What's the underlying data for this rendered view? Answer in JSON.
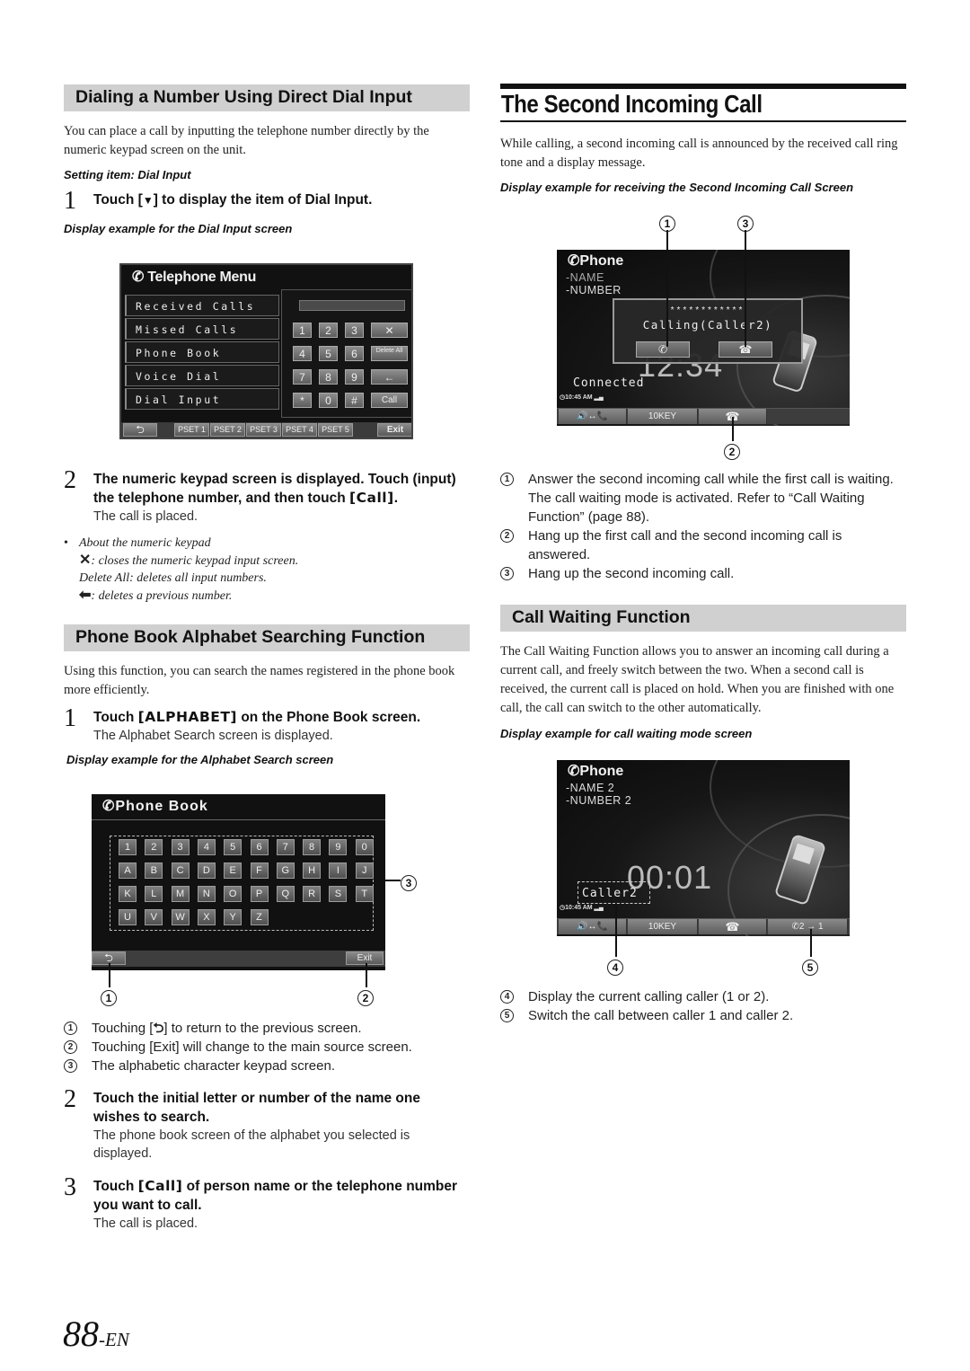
{
  "left": {
    "dial_section": {
      "heading": "Dialing a Number Using Direct Dial Input",
      "intro": "You can place a call by inputting the telephone number directly by the numeric keypad screen on the unit.",
      "setting_item": "Setting item: Dial Input",
      "step1": {
        "num": "1",
        "title_pre": "Touch [",
        "title_icon": "▼",
        "title_post": "] to display the item of Dial Input."
      },
      "caption": "Display example for the Dial Input screen",
      "screen": {
        "title": "Telephone Menu",
        "menu_items": [
          "Received Calls",
          "Missed Calls",
          "Phone Book",
          "Voice Dial",
          "Dial Input"
        ],
        "keypad_rows": [
          [
            "1",
            "2",
            "3",
            "✕"
          ],
          [
            "4",
            "5",
            "6",
            "Delete All"
          ],
          [
            "7",
            "8",
            "9",
            "←"
          ],
          [
            "*",
            "0",
            "#",
            "Call"
          ]
        ],
        "bottom_buttons": [
          "PSET 1",
          "PSET 2",
          "PSET 3",
          "PSET 4",
          "PSET 5"
        ],
        "back_label": "⮌",
        "exit_label": "Exit"
      },
      "step2": {
        "num": "2",
        "title_a": "The numeric keypad screen is displayed. Touch (input) the telephone number, and then touch ",
        "title_key": "[Call]",
        "title_b": ".",
        "note": "The call is placed."
      },
      "keypad_notes": {
        "bullet": "About the numeric keypad",
        "close_desc": ": closes the numeric keypad input screen.",
        "delete_all_desc": "Delete All: deletes all input numbers.",
        "backspace_desc": ": deletes a previous number."
      }
    },
    "alpha_section": {
      "heading": "Phone Book Alphabet Searching Function",
      "intro": "Using this function, you can search the names registered in the phone book more efficiently.",
      "step1": {
        "num": "1",
        "title_pre": "Touch ",
        "title_key": "[ALPHABET]",
        "title_post": " on the Phone Book screen.",
        "note": "The Alphabet Search screen is displayed."
      },
      "caption": "Display example for the Alphabet Search screen",
      "screen": {
        "title": "Phone Book",
        "keys": [
          [
            "1",
            "2",
            "3",
            "4",
            "5",
            "6",
            "7",
            "8",
            "9",
            "0"
          ],
          [
            "A",
            "B",
            "C",
            "D",
            "E",
            "F",
            "G",
            "H",
            "I",
            "J"
          ],
          [
            "K",
            "L",
            "M",
            "N",
            "O",
            "P",
            "Q",
            "R",
            "S",
            "T"
          ],
          [
            "U",
            "V",
            "W",
            "X",
            "Y",
            "Z"
          ]
        ],
        "exit_label": "Exit"
      },
      "callouts": [
        {
          "num": "1",
          "pre": "Touching [",
          "post": "] to return to the previous screen."
        },
        {
          "num": "2",
          "text": "Touching [Exit] will change to the main source screen."
        },
        {
          "num": "3",
          "text": "The alphabetic character keypad screen."
        }
      ],
      "step2": {
        "num": "2",
        "title": "Touch the initial letter or number of the name one wishes to search.",
        "note": "The phone book screen of the alphabet you selected is displayed."
      },
      "step3": {
        "num": "3",
        "title_pre": "Touch ",
        "title_key": "[Call]",
        "title_post": " of person name or the telephone number you want to call.",
        "note": "The call is placed."
      }
    }
  },
  "right": {
    "second_call": {
      "heading": "The Second Incoming Call",
      "intro": "While calling, a second incoming call is announced by the received call ring tone and a display message.",
      "caption": "Display example for receiving the Second Incoming Call Screen",
      "screen": {
        "title": "Phone",
        "name": "-NAME",
        "number": "-NUMBER",
        "stars": "************",
        "message": "Calling(Caller2)",
        "timer": "12:34",
        "status_text": "Connected",
        "clock": "10:45",
        "ampm": "AM",
        "bar_buttons": [
          "🔊↔📞",
          "10KEY",
          "hang-up"
        ]
      },
      "callout_labels": [
        "1",
        "2",
        "3"
      ],
      "callouts": [
        {
          "num": "1",
          "text": "Answer the second incoming call while the first call is waiting. The call waiting mode is activated. Refer to “Call Waiting Function” (page 88)."
        },
        {
          "num": "2",
          "text": "Hang up the first call and the second incoming call is answered."
        },
        {
          "num": "3",
          "text": "Hang up the second incoming call."
        }
      ]
    },
    "call_waiting": {
      "heading": "Call Waiting Function",
      "intro": "The Call Waiting Function allows you to answer an incoming call during a current call, and freely switch between the two. When a second call is received, the current call is placed on hold. When you are finished with one call, the call can switch to the other automatically.",
      "caption": "Display example for call waiting mode screen",
      "screen": {
        "title": "Phone",
        "name": "-NAME 2",
        "number": "-NUMBER 2",
        "timer": "00:01",
        "caller_label": "Caller2",
        "clock": "10:45",
        "ampm": "AM",
        "bar_buttons": [
          "🔊↔📞",
          "10KEY",
          "hang-up",
          "2 → 1"
        ]
      },
      "callout_labels": [
        "4",
        "5"
      ],
      "callouts": [
        {
          "num": "4",
          "text": "Display the current calling caller (1 or 2)."
        },
        {
          "num": "5",
          "text": "Switch the call between caller 1 and caller 2."
        }
      ]
    }
  },
  "footer": {
    "page_number": "88",
    "suffix": "-EN"
  }
}
